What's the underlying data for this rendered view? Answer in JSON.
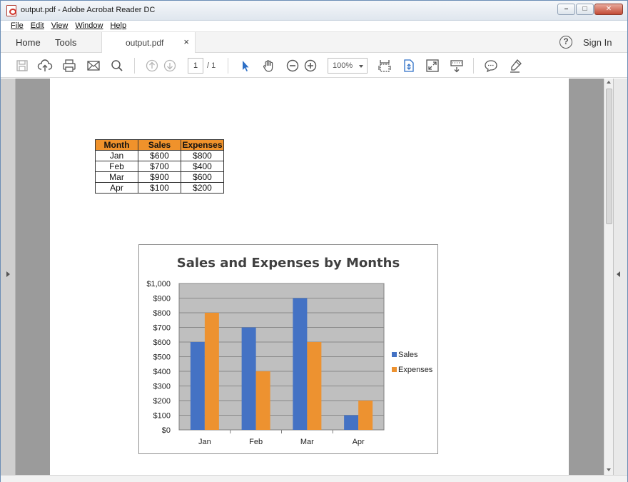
{
  "window": {
    "title": "output.pdf - Adobe Acrobat Reader DC",
    "controls": {
      "minimize": "–",
      "maximize": "□",
      "close": "✕"
    }
  },
  "menu": [
    "File",
    "Edit",
    "View",
    "Window",
    "Help"
  ],
  "nav": {
    "home": "Home",
    "tools": "Tools",
    "tab_label": "output.pdf",
    "tab_close": "×",
    "help": "?",
    "sign_in": "Sign In"
  },
  "toolbar": {
    "page_current": "1",
    "page_total": "/ 1",
    "zoom": "100%",
    "icons": [
      "save-icon",
      "cloud-upload-icon",
      "print-icon",
      "mail-icon",
      "search-icon",
      "page-up-icon",
      "page-down-icon",
      "select-arrow-icon",
      "hand-tool-icon",
      "zoom-out-icon",
      "zoom-in-icon",
      "fit-page-icon",
      "scroll-mode-icon",
      "fullscreen-icon",
      "read-mode-icon",
      "comment-icon",
      "highlight-icon"
    ]
  },
  "table": {
    "headers": [
      "Month",
      "Sales",
      "Expenses"
    ],
    "rows": [
      [
        "Jan",
        "$600",
        "$800"
      ],
      [
        "Feb",
        "$700",
        "$400"
      ],
      [
        "Mar",
        "$900",
        "$600"
      ],
      [
        "Apr",
        "$100",
        "$200"
      ]
    ]
  },
  "colors": {
    "sales": "#4472c4",
    "expenses": "#ed9230",
    "plot_bg": "#bfbfbf",
    "header_bg": "#f0922b"
  },
  "chart_data": {
    "type": "bar",
    "title": "Sales and Expenses by Months",
    "categories": [
      "Jan",
      "Feb",
      "Mar",
      "Apr"
    ],
    "series": [
      {
        "name": "Sales",
        "values": [
          600,
          700,
          900,
          100
        ]
      },
      {
        "name": "Expenses",
        "values": [
          800,
          400,
          600,
          200
        ]
      }
    ],
    "ylim": [
      0,
      1000
    ],
    "yticks": [
      "$0",
      "$100",
      "$200",
      "$300",
      "$400",
      "$500",
      "$600",
      "$700",
      "$800",
      "$900",
      "$1,000"
    ],
    "xlabel": "",
    "ylabel": "",
    "grid": true,
    "legend": "right"
  }
}
